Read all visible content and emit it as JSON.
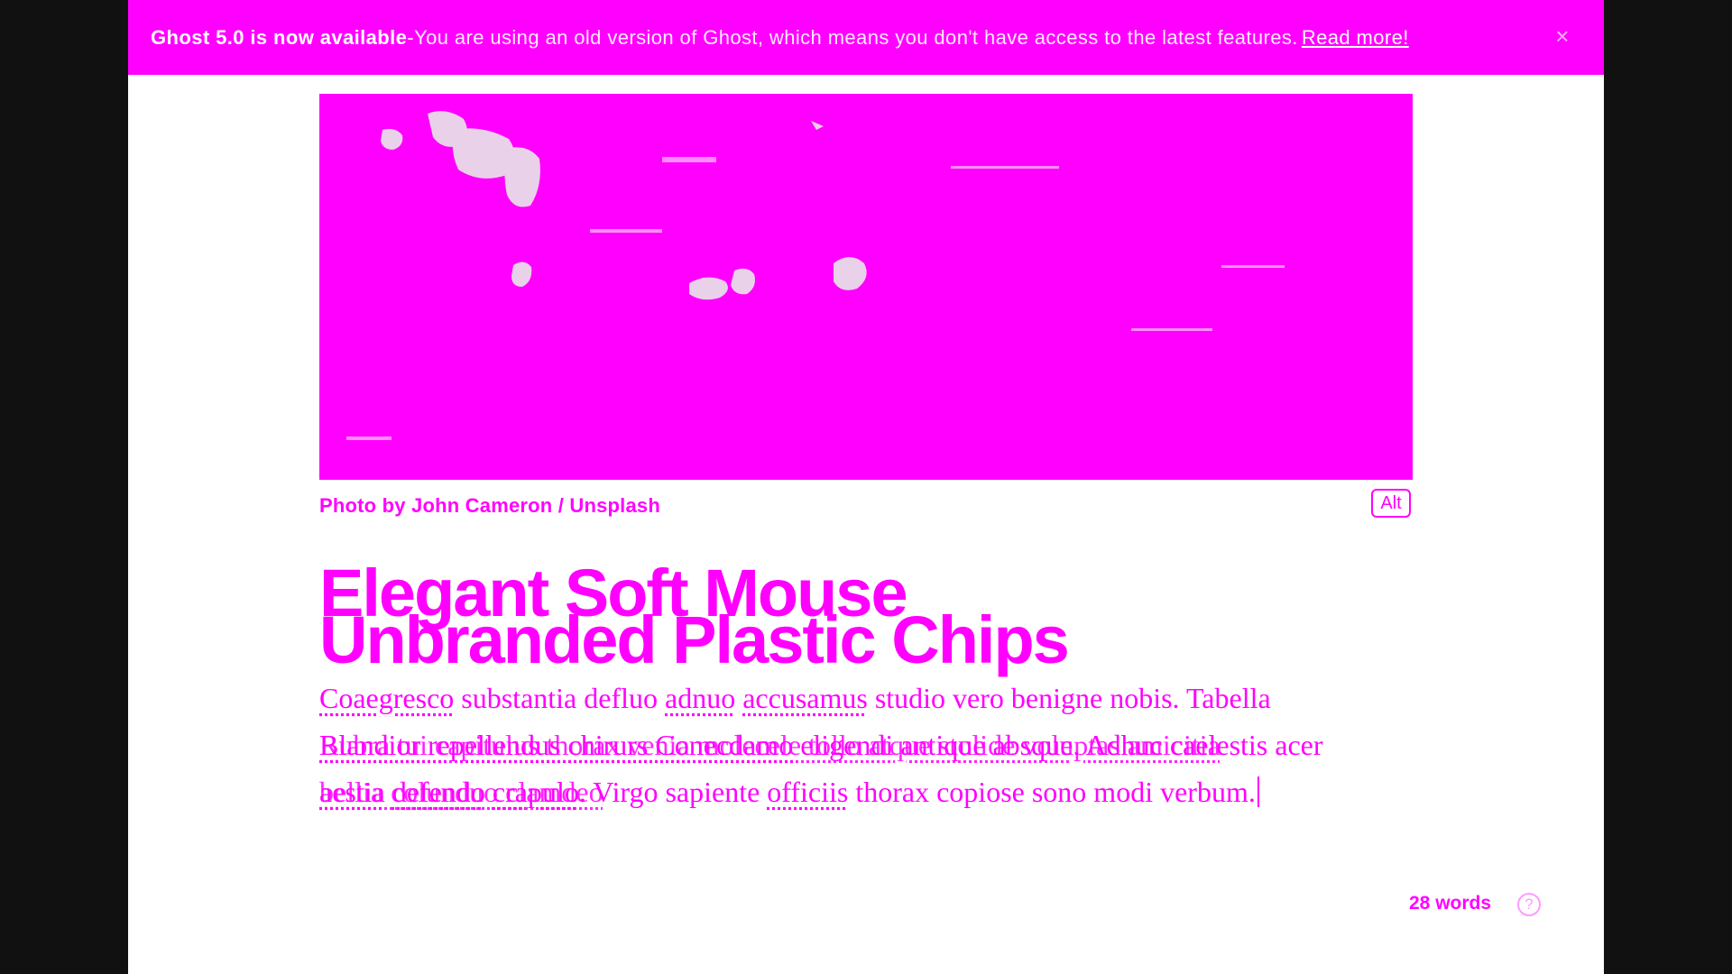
{
  "colors": {
    "accent": "#ff00ff",
    "page_background": "#ffffff",
    "outer_background": "#111111"
  },
  "banner": {
    "title": "Ghost 5.0 is now available",
    "separator": " - ",
    "message": "You are using an old version of Ghost, which means you don't have access to the latest features.",
    "read_more": "Read more!",
    "close_icon": "×"
  },
  "feature_image": {
    "caption": "Photo by John Cameron / Unsplash",
    "alt_button": "Alt"
  },
  "post": {
    "title_line1": "Elegant Soft Mouse",
    "title_line2": "Unbranded Plastic Chips",
    "body": {
      "line1": {
        "w1": "Coaegresco",
        "t1": " substantia defluo ",
        "w2": "adnuo",
        "t2": " ",
        "w3": "accusamus",
        "t3": " studio vero benigne nobis. Tabella"
      },
      "line2": {
        "a": "Blandior repellendus chirurs ",
        "b": "Conecdamo",
        "c": " eligendi antique absque. Adhuc caelestis acer"
      },
      "line2_overlay": "Rubra tui capitulus thorax venia molecele tollo atque stolide voluptas amicitia",
      "line3": {
        "w1": "aestia",
        "t1": " ",
        "w2": "defendo",
        "t2": " ",
        "w3": "crapulo",
        "t3": ". Virgo sapiente ",
        "w4": "officiis",
        "t4": " thorax copiose sono modi verbum."
      },
      "line3_overlay": "bellia colunduo clamdeo"
    }
  },
  "status": {
    "word_count": "28 words",
    "help_icon": "?"
  }
}
